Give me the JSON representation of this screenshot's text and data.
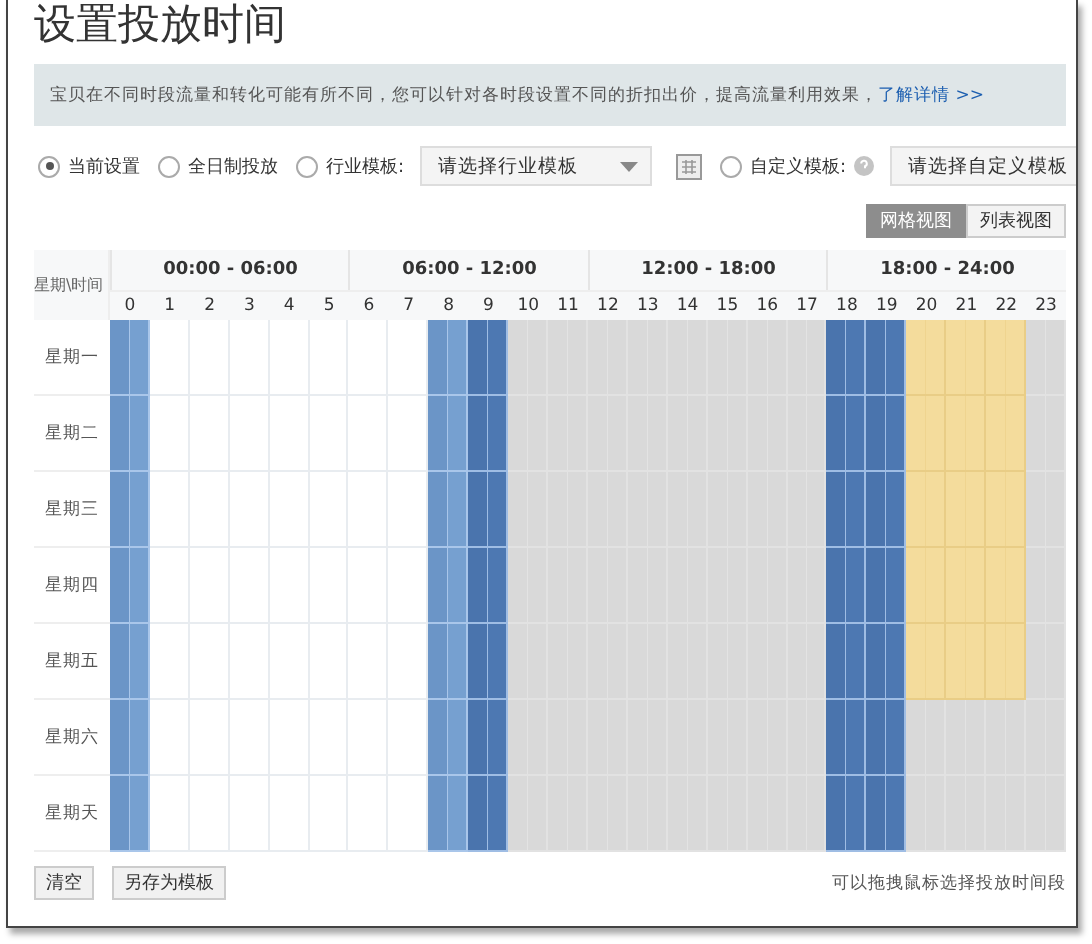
{
  "title": "设置投放时间",
  "notice": {
    "text": "宝贝在不同时段流量和转化可能有所不同，您可以针对各时段设置不同的折扣出价，提高流量利用效果，",
    "link": "了解详情 >>"
  },
  "options": [
    {
      "kind": "radio",
      "label": "当前设置",
      "selected": true
    },
    {
      "kind": "radio",
      "label": "全日制投放",
      "selected": false
    },
    {
      "kind": "radio-select",
      "label": "行业模板:",
      "selected": false,
      "placeholder": "请选择行业模板"
    },
    {
      "kind": "radio-select",
      "label": "自定义模板:",
      "selected": false,
      "placeholder": "请选择自定义模板",
      "help": true
    }
  ],
  "views": [
    {
      "label": "网格视图",
      "selected": true
    },
    {
      "label": "列表视图",
      "selected": false
    }
  ],
  "grid": {
    "corner": "星期\\时间",
    "groups": [
      "00:00 - 06:00",
      "06:00 - 12:00",
      "12:00 - 18:00",
      "18:00 - 24:00"
    ],
    "hours": [
      "0",
      "1",
      "2",
      "3",
      "4",
      "5",
      "6",
      "7",
      "8",
      "9",
      "10",
      "11",
      "12",
      "13",
      "14",
      "15",
      "16",
      "17",
      "18",
      "19",
      "20",
      "21",
      "22",
      "23"
    ],
    "rows": [
      {
        "day": "星期一",
        "cells": [
          {
            "kind": "blue"
          },
          {
            "kind": "empty"
          },
          {
            "kind": "empty"
          },
          {
            "kind": "empty"
          },
          {
            "kind": "empty"
          },
          {
            "kind": "empty"
          },
          {
            "kind": "empty"
          },
          {
            "kind": "empty"
          },
          {
            "kind": "blue"
          },
          {
            "kind": "dark"
          },
          {
            "kind": "grey"
          },
          {
            "kind": "grey"
          },
          {
            "kind": "grey"
          },
          {
            "kind": "grey"
          },
          {
            "kind": "grey"
          },
          {
            "kind": "grey"
          },
          {
            "kind": "grey"
          },
          {
            "kind": "grey"
          },
          {
            "kind": "dark"
          },
          {
            "kind": "dark"
          },
          {
            "kind": "yellow"
          },
          {
            "kind": "yellow"
          },
          {
            "kind": "yellow"
          },
          {
            "kind": "grey"
          }
        ]
      },
      {
        "day": "星期二",
        "cells": [
          {
            "kind": "blue"
          },
          {
            "kind": "empty"
          },
          {
            "kind": "empty"
          },
          {
            "kind": "empty"
          },
          {
            "kind": "empty"
          },
          {
            "kind": "empty"
          },
          {
            "kind": "empty"
          },
          {
            "kind": "empty"
          },
          {
            "kind": "blue"
          },
          {
            "kind": "dark"
          },
          {
            "kind": "grey"
          },
          {
            "kind": "grey"
          },
          {
            "kind": "grey"
          },
          {
            "kind": "grey"
          },
          {
            "kind": "grey"
          },
          {
            "kind": "grey"
          },
          {
            "kind": "grey"
          },
          {
            "kind": "grey"
          },
          {
            "kind": "dark"
          },
          {
            "kind": "dark"
          },
          {
            "kind": "yellow"
          },
          {
            "kind": "yellow"
          },
          {
            "kind": "yellow"
          },
          {
            "kind": "grey"
          }
        ]
      },
      {
        "day": "星期三",
        "cells": [
          {
            "kind": "blue"
          },
          {
            "kind": "empty"
          },
          {
            "kind": "empty"
          },
          {
            "kind": "empty"
          },
          {
            "kind": "empty"
          },
          {
            "kind": "empty"
          },
          {
            "kind": "empty"
          },
          {
            "kind": "empty"
          },
          {
            "kind": "blue"
          },
          {
            "kind": "dark"
          },
          {
            "kind": "grey"
          },
          {
            "kind": "grey"
          },
          {
            "kind": "grey"
          },
          {
            "kind": "grey"
          },
          {
            "kind": "grey"
          },
          {
            "kind": "grey"
          },
          {
            "kind": "grey"
          },
          {
            "kind": "grey"
          },
          {
            "kind": "dark"
          },
          {
            "kind": "dark"
          },
          {
            "kind": "yellow"
          },
          {
            "kind": "yellow"
          },
          {
            "kind": "yellow"
          },
          {
            "kind": "grey"
          }
        ]
      },
      {
        "day": "星期四",
        "cells": [
          {
            "kind": "blue"
          },
          {
            "kind": "empty"
          },
          {
            "kind": "empty"
          },
          {
            "kind": "empty"
          },
          {
            "kind": "empty"
          },
          {
            "kind": "empty"
          },
          {
            "kind": "empty"
          },
          {
            "kind": "empty"
          },
          {
            "kind": "blue"
          },
          {
            "kind": "dark"
          },
          {
            "kind": "grey"
          },
          {
            "kind": "grey"
          },
          {
            "kind": "grey"
          },
          {
            "kind": "grey"
          },
          {
            "kind": "grey"
          },
          {
            "kind": "grey"
          },
          {
            "kind": "grey"
          },
          {
            "kind": "grey"
          },
          {
            "kind": "dark"
          },
          {
            "kind": "dark"
          },
          {
            "kind": "yellow"
          },
          {
            "kind": "yellow"
          },
          {
            "kind": "yellow"
          },
          {
            "kind": "grey"
          }
        ]
      },
      {
        "day": "星期五",
        "cells": [
          {
            "kind": "blue"
          },
          {
            "kind": "empty"
          },
          {
            "kind": "empty"
          },
          {
            "kind": "empty"
          },
          {
            "kind": "empty"
          },
          {
            "kind": "empty"
          },
          {
            "kind": "empty"
          },
          {
            "kind": "empty"
          },
          {
            "kind": "blue"
          },
          {
            "kind": "dark"
          },
          {
            "kind": "grey"
          },
          {
            "kind": "grey"
          },
          {
            "kind": "grey"
          },
          {
            "kind": "grey"
          },
          {
            "kind": "grey"
          },
          {
            "kind": "grey"
          },
          {
            "kind": "grey"
          },
          {
            "kind": "grey"
          },
          {
            "kind": "dark"
          },
          {
            "kind": "dark"
          },
          {
            "kind": "yellow"
          },
          {
            "kind": "yellow"
          },
          {
            "kind": "yellow"
          },
          {
            "kind": "grey"
          }
        ]
      },
      {
        "day": "星期六",
        "cells": [
          {
            "kind": "blue"
          },
          {
            "kind": "empty"
          },
          {
            "kind": "empty"
          },
          {
            "kind": "empty"
          },
          {
            "kind": "empty"
          },
          {
            "kind": "empty"
          },
          {
            "kind": "empty"
          },
          {
            "kind": "empty"
          },
          {
            "kind": "blue"
          },
          {
            "kind": "dark"
          },
          {
            "kind": "grey"
          },
          {
            "kind": "grey"
          },
          {
            "kind": "grey"
          },
          {
            "kind": "grey"
          },
          {
            "kind": "grey"
          },
          {
            "kind": "grey"
          },
          {
            "kind": "grey"
          },
          {
            "kind": "grey"
          },
          {
            "kind": "dark"
          },
          {
            "kind": "dark"
          },
          {
            "kind": "grey"
          },
          {
            "kind": "grey"
          },
          {
            "kind": "grey"
          },
          {
            "kind": "grey"
          }
        ]
      },
      {
        "day": "星期天",
        "cells": [
          {
            "kind": "blue"
          },
          {
            "kind": "empty"
          },
          {
            "kind": "empty"
          },
          {
            "kind": "empty"
          },
          {
            "kind": "empty"
          },
          {
            "kind": "empty"
          },
          {
            "kind": "empty"
          },
          {
            "kind": "empty"
          },
          {
            "kind": "blue"
          },
          {
            "kind": "dark"
          },
          {
            "kind": "grey"
          },
          {
            "kind": "grey"
          },
          {
            "kind": "grey"
          },
          {
            "kind": "grey"
          },
          {
            "kind": "grey"
          },
          {
            "kind": "grey"
          },
          {
            "kind": "grey"
          },
          {
            "kind": "grey"
          },
          {
            "kind": "dark"
          },
          {
            "kind": "dark"
          },
          {
            "kind": "grey"
          },
          {
            "kind": "grey"
          },
          {
            "kind": "grey"
          },
          {
            "kind": "grey"
          }
        ]
      }
    ]
  },
  "actions": [
    "清空",
    "另存为模板"
  ],
  "hint": "可以拖拽鼠标选择投放时间段"
}
